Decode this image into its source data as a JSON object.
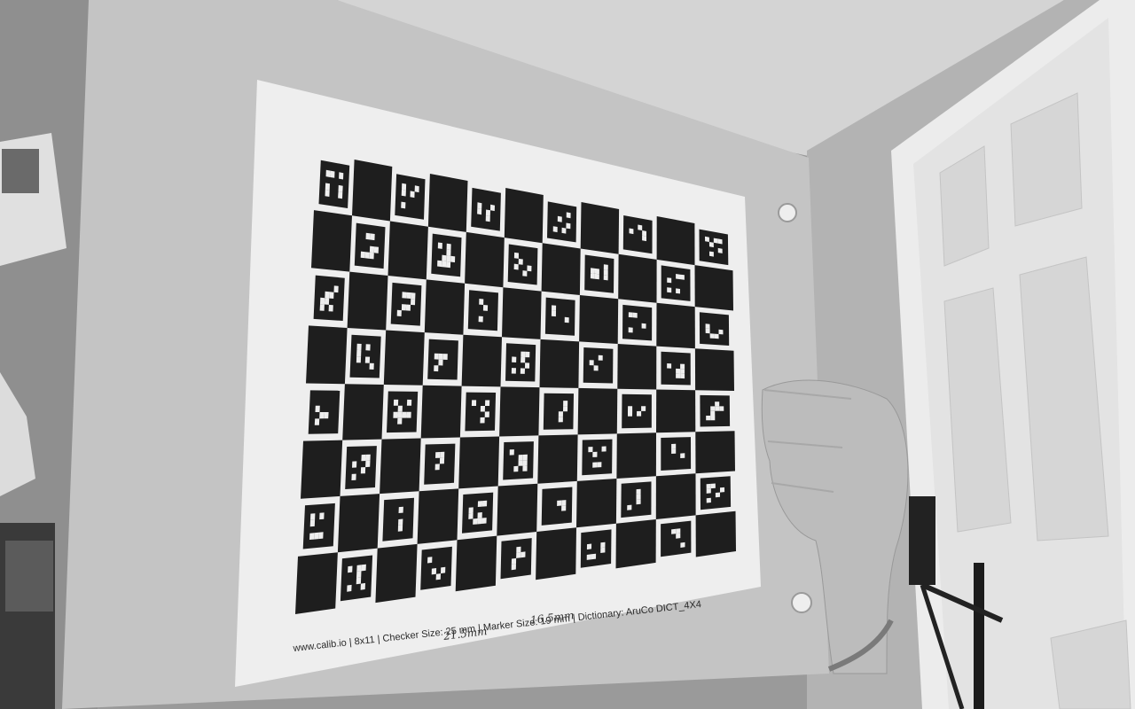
{
  "scene": {
    "palette": {
      "wall": "#9c9c9c",
      "ceiling": "#cfcfcf",
      "board": "#c2c2c2",
      "paper": "#eeeeee",
      "ink": "#1e1e1e",
      "door": "#e6e6e6",
      "skin": "#bdbdbd"
    }
  },
  "calibration_target": {
    "footer_caption": "www.calib.io | 8x11 | Checker Size: 25 mm | Marker Size: 19 mm | Dictionary: AruCo DICT_4X4",
    "handwritten_checker": "21.5mm",
    "handwritten_marker": "16.5mm"
  }
}
